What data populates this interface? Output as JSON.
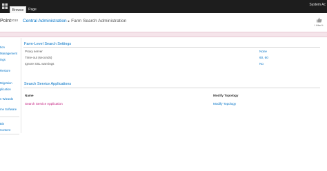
{
  "ribbon": {
    "tabs": [
      {
        "label": "Browse",
        "active": true
      },
      {
        "label": "Page",
        "active": false
      }
    ],
    "user": "System Ac"
  },
  "header": {
    "brand": "Point",
    "brand_version": "2010",
    "breadcrumb_root": "Central Administration",
    "breadcrumb_separator": "▸",
    "breadcrumb_current": "Farm Search Administration",
    "like_label": "I Like It"
  },
  "leftnav": {
    "items": [
      "tion",
      "Management",
      "ings",
      "Restore",
      "Migration",
      "plication",
      "n Wizards",
      "me Software",
      "Bin",
      "Content"
    ]
  },
  "farm_settings": {
    "title": "Farm-Level Search Settings",
    "rows": [
      {
        "label": "Proxy server",
        "value": "None"
      },
      {
        "label": "Time-out (seconds)",
        "value": "60, 60"
      },
      {
        "label": "Ignore SSL warnings",
        "value": "No"
      }
    ]
  },
  "service_apps": {
    "title": "Search Service Applications",
    "columns": {
      "name": "Name",
      "modify": "Modify Topology"
    },
    "rows": [
      {
        "name": "Search Service Application",
        "modify": "Modify Topology"
      }
    ]
  },
  "colors": {
    "ribbon_bg": "#1d1d1d",
    "link_blue": "#0072c6",
    "link_magenta": "#c0167a",
    "alert_band": "#f5e4ea"
  }
}
